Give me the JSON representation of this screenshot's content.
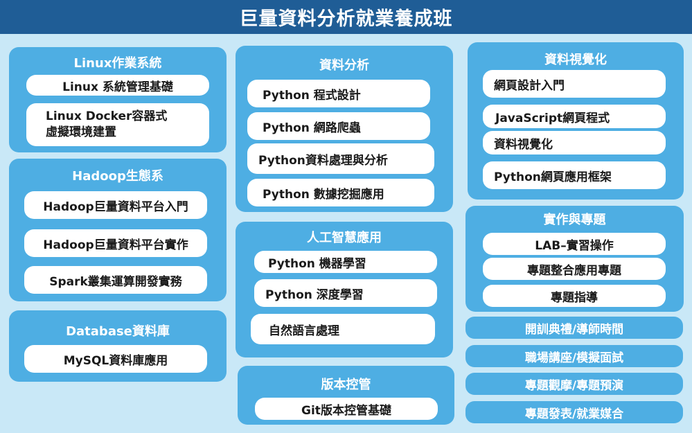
{
  "title": "巨量資料分析就業養成班",
  "linux": {
    "title": "Linux作業系統",
    "items": [
      "Linux 系統管理基礎",
      "Linux Docker容器式",
      "虛擬環境建置"
    ]
  },
  "hadoop": {
    "title": "Hadoop生態系",
    "items": [
      "Hadoop巨量資料平台入門",
      "Hadoop巨量資料平台實作",
      "Spark叢集運算開發實務"
    ]
  },
  "database": {
    "title": "Database資料庫",
    "items": [
      "MySQL資料庫應用"
    ]
  },
  "analysis": {
    "title": "資料分析",
    "items": [
      "Python 程式設計",
      "Python 網路爬蟲",
      "Python資料處理與分析",
      "Python 數據挖掘應用"
    ]
  },
  "ai": {
    "title": "人工智慧應用",
    "items": [
      "Python 機器學習",
      "Python 深度學習",
      "自然語言處理"
    ]
  },
  "vc": {
    "title": "版本控管",
    "items": [
      "Git版本控管基礎"
    ]
  },
  "viz": {
    "title": "資料視覺化",
    "items": [
      "網頁設計入門",
      "JavaScript網頁程式",
      "資料視覺化",
      "Python網頁應用框架"
    ]
  },
  "project": {
    "title": "實作與專題",
    "items": [
      "LAB–實習操作",
      "專題整合應用專題",
      "專題指導"
    ]
  },
  "events": [
    "開訓典禮/導師時間",
    "職場講座/模擬面試",
    "專題觀摩/專題預演",
    "專題發表/就業媒合"
  ],
  "colors": {
    "header": "#1f5d96",
    "panel": "#4eaee3",
    "background": "#c9e8f7",
    "pill": "#ffffff"
  }
}
